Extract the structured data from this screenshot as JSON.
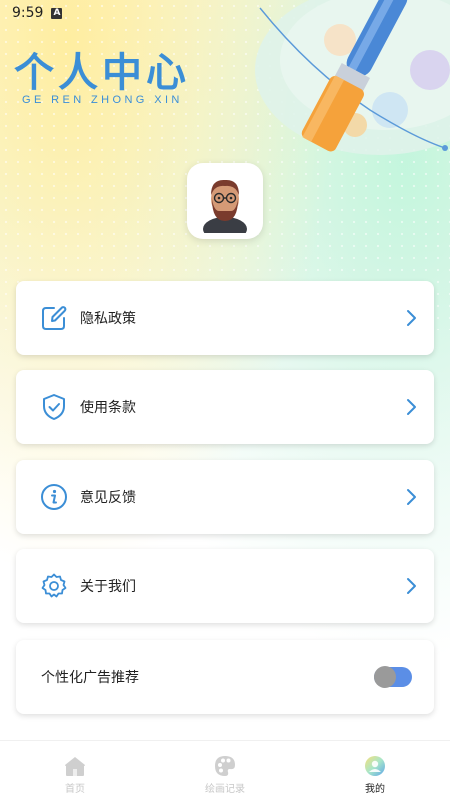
{
  "status_bar": {
    "time": "9:59",
    "notification_badge": "A"
  },
  "header": {
    "title_cn": "个人中心",
    "title_en": "GE REN ZHONG XIN"
  },
  "menu": {
    "items": [
      {
        "label": "隐私政策",
        "icon": "edit-icon"
      },
      {
        "label": "使用条款",
        "icon": "shield-check-icon"
      },
      {
        "label": "意见反馈",
        "icon": "info-icon"
      },
      {
        "label": "关于我们",
        "icon": "gear-icon"
      }
    ],
    "ad_toggle": {
      "label": "个性化广告推荐",
      "state": "on"
    }
  },
  "bottom_nav": {
    "items": [
      {
        "label": "首页",
        "icon": "home-icon",
        "active": false
      },
      {
        "label": "绘画记录",
        "icon": "palette-icon",
        "active": false
      },
      {
        "label": "我的",
        "icon": "profile-icon",
        "active": true
      }
    ]
  },
  "colors": {
    "accent": "#3b8ed6",
    "toggle_on": "#5b8ee6"
  }
}
